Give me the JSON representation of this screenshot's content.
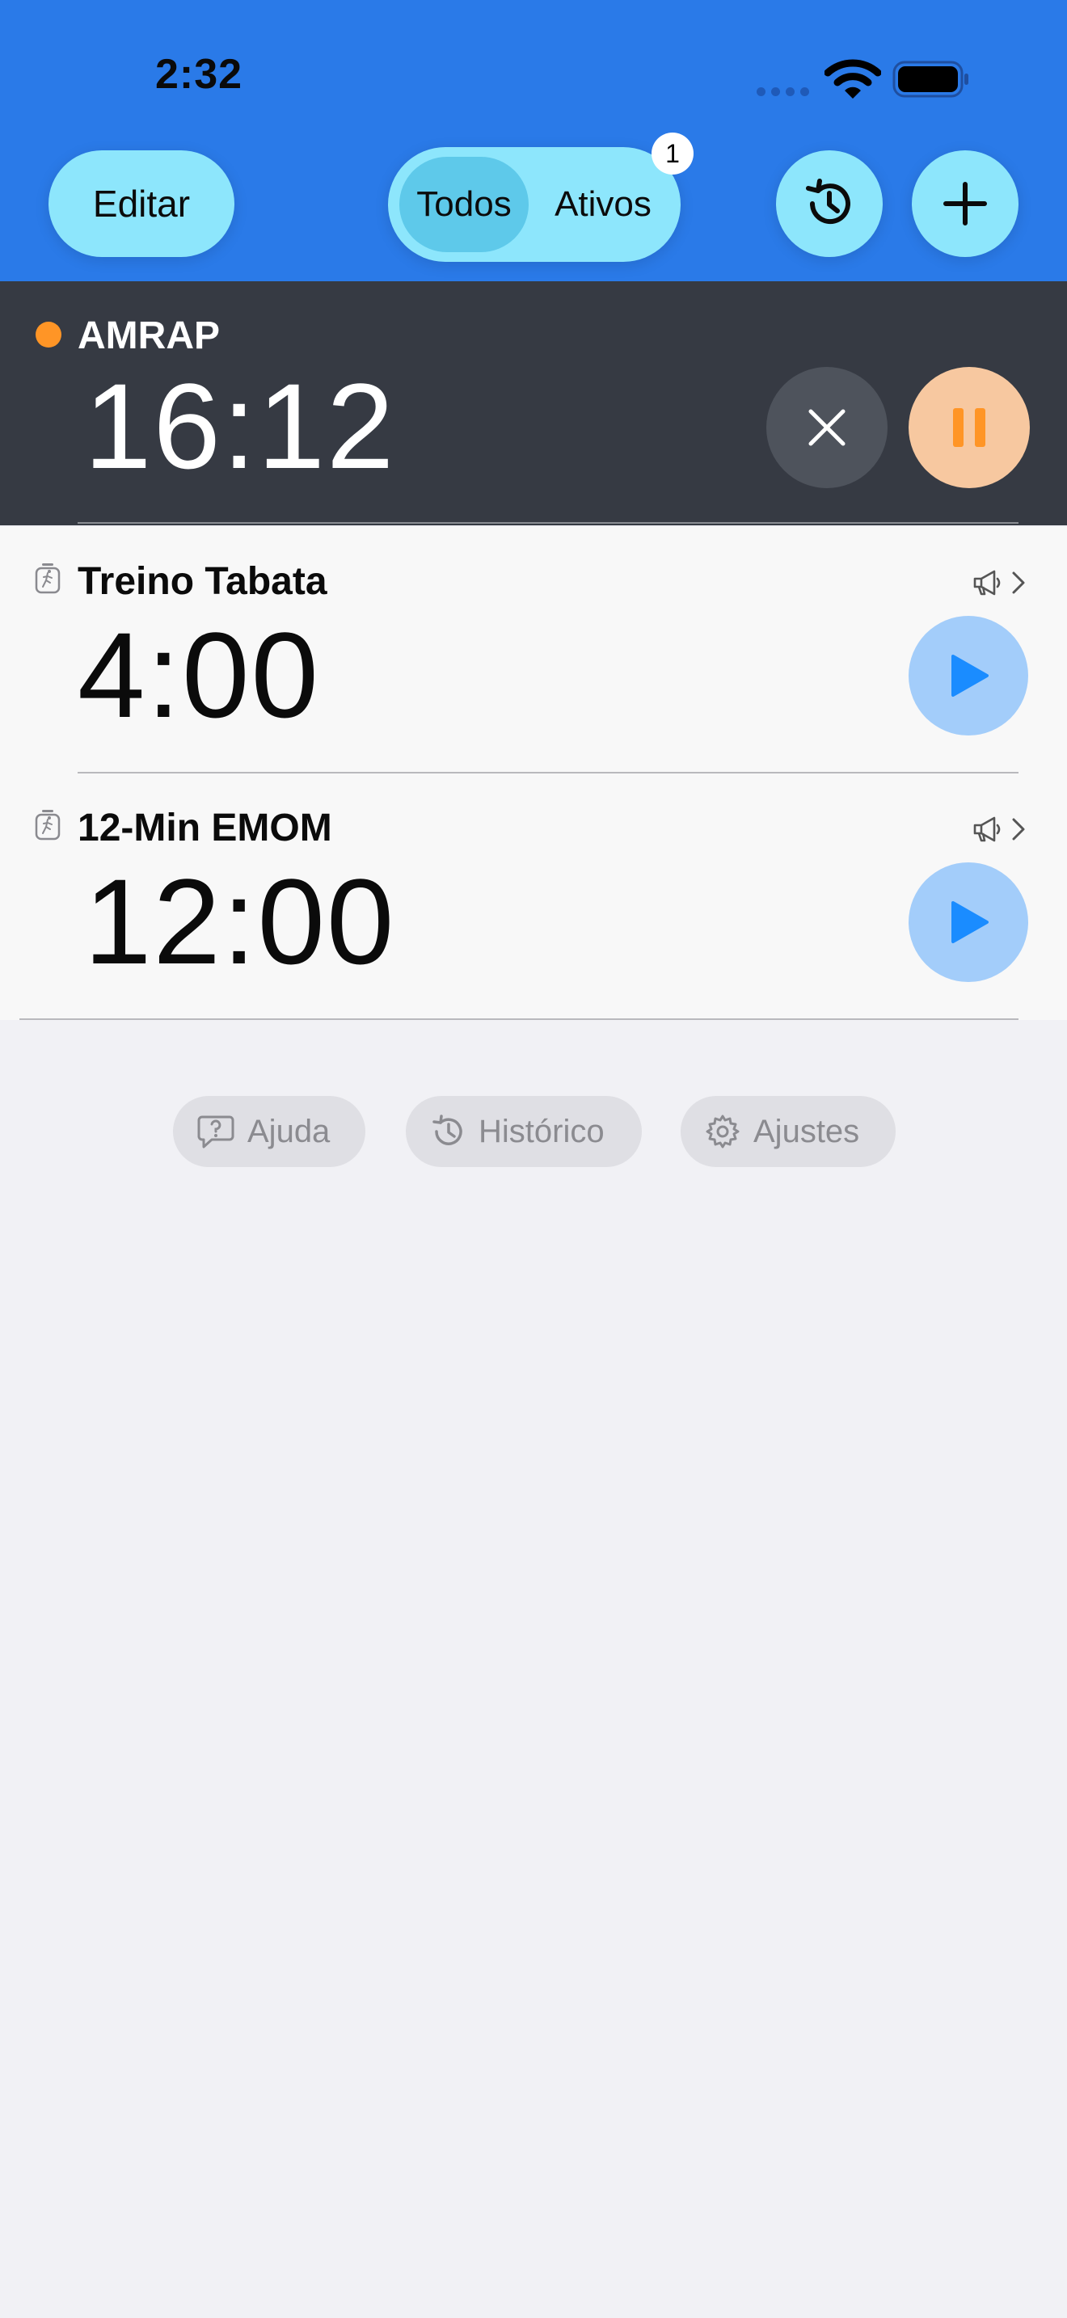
{
  "status_bar": {
    "time": "2:32",
    "icons": [
      "signal-icon",
      "wifi-icon",
      "battery-icon"
    ]
  },
  "toolbar": {
    "edit_label": "Editar",
    "filter": {
      "options": [
        "Todos",
        "Ativos"
      ],
      "selected": "Todos",
      "active_badge": "1"
    },
    "history_icon": "history-icon",
    "add_icon": "plus-icon"
  },
  "active_timer": {
    "title": "AMRAP",
    "time": "16:12",
    "status_color": "#ff9526",
    "cancel_icon": "close-icon",
    "pause_icon": "pause-icon"
  },
  "timers": [
    {
      "title": "Treino Tabata",
      "time": "4:00",
      "icon": "stopwatch-figure-icon"
    },
    {
      "title": "12-Min EMOM",
      "time": "12:00",
      "icon": "stopwatch-figure-icon"
    }
  ],
  "footer_chips": [
    {
      "label": "Ajuda",
      "icon": "help-bubble-icon"
    },
    {
      "label": "Histórico",
      "icon": "history-icon"
    },
    {
      "label": "Ajustes",
      "icon": "gear-icon"
    }
  ],
  "colors": {
    "header_bg": "#2a7ae8",
    "button_bg": "#8de6fc",
    "active_row_bg": "#363a43",
    "pause_bg": "#f7c8a0",
    "pause_accent": "#ff9526",
    "play_bg": "#a3cdfa",
    "play_accent": "#1a8cff",
    "page_bg": "#f1f1f5"
  }
}
